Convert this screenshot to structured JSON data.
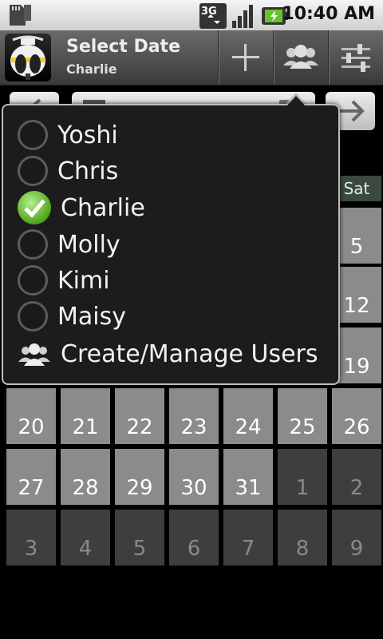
{
  "status_bar": {
    "time": "10:40 AM",
    "network": "3G"
  },
  "action_bar": {
    "title": "Select Date",
    "subtitle": "Charlie",
    "buttons": [
      "add-icon",
      "users-icon",
      "settings-sliders-icon"
    ]
  },
  "calendar": {
    "visible_header": "Sat",
    "rows": [
      [
        {
          "d": "",
          "c": false
        },
        {
          "d": "",
          "c": false
        },
        {
          "d": "",
          "c": false
        },
        {
          "d": "",
          "c": false
        },
        {
          "d": "",
          "c": false
        },
        {
          "d": "",
          "c": false
        },
        {
          "d": "5",
          "c": true
        }
      ],
      [
        {
          "d": "",
          "c": false
        },
        {
          "d": "",
          "c": false
        },
        {
          "d": "",
          "c": false
        },
        {
          "d": "",
          "c": false
        },
        {
          "d": "",
          "c": false
        },
        {
          "d": "",
          "c": false
        },
        {
          "d": "12",
          "c": true
        }
      ],
      [
        {
          "d": "",
          "c": false
        },
        {
          "d": "",
          "c": false
        },
        {
          "d": "",
          "c": false
        },
        {
          "d": "",
          "c": false
        },
        {
          "d": "",
          "c": false
        },
        {
          "d": "",
          "c": false
        },
        {
          "d": "19",
          "c": true
        }
      ],
      [
        {
          "d": "20",
          "c": true
        },
        {
          "d": "21",
          "c": true
        },
        {
          "d": "22",
          "c": true
        },
        {
          "d": "23",
          "c": true
        },
        {
          "d": "24",
          "c": true
        },
        {
          "d": "25",
          "c": true
        },
        {
          "d": "26",
          "c": true
        }
      ],
      [
        {
          "d": "27",
          "c": true
        },
        {
          "d": "28",
          "c": true
        },
        {
          "d": "29",
          "c": true
        },
        {
          "d": "30",
          "c": true
        },
        {
          "d": "31",
          "c": true
        },
        {
          "d": "1",
          "c": false
        },
        {
          "d": "2",
          "c": false
        }
      ],
      [
        {
          "d": "3",
          "c": false
        },
        {
          "d": "4",
          "c": false
        },
        {
          "d": "5",
          "c": false
        },
        {
          "d": "6",
          "c": false
        },
        {
          "d": "7",
          "c": false
        },
        {
          "d": "8",
          "c": false
        },
        {
          "d": "9",
          "c": false
        }
      ]
    ]
  },
  "user_menu": {
    "selected": "Charlie",
    "users": [
      "Yoshi",
      "Chris",
      "Charlie",
      "Molly",
      "Kimi",
      "Maisy"
    ],
    "manage_label": "Create/Manage Users"
  }
}
